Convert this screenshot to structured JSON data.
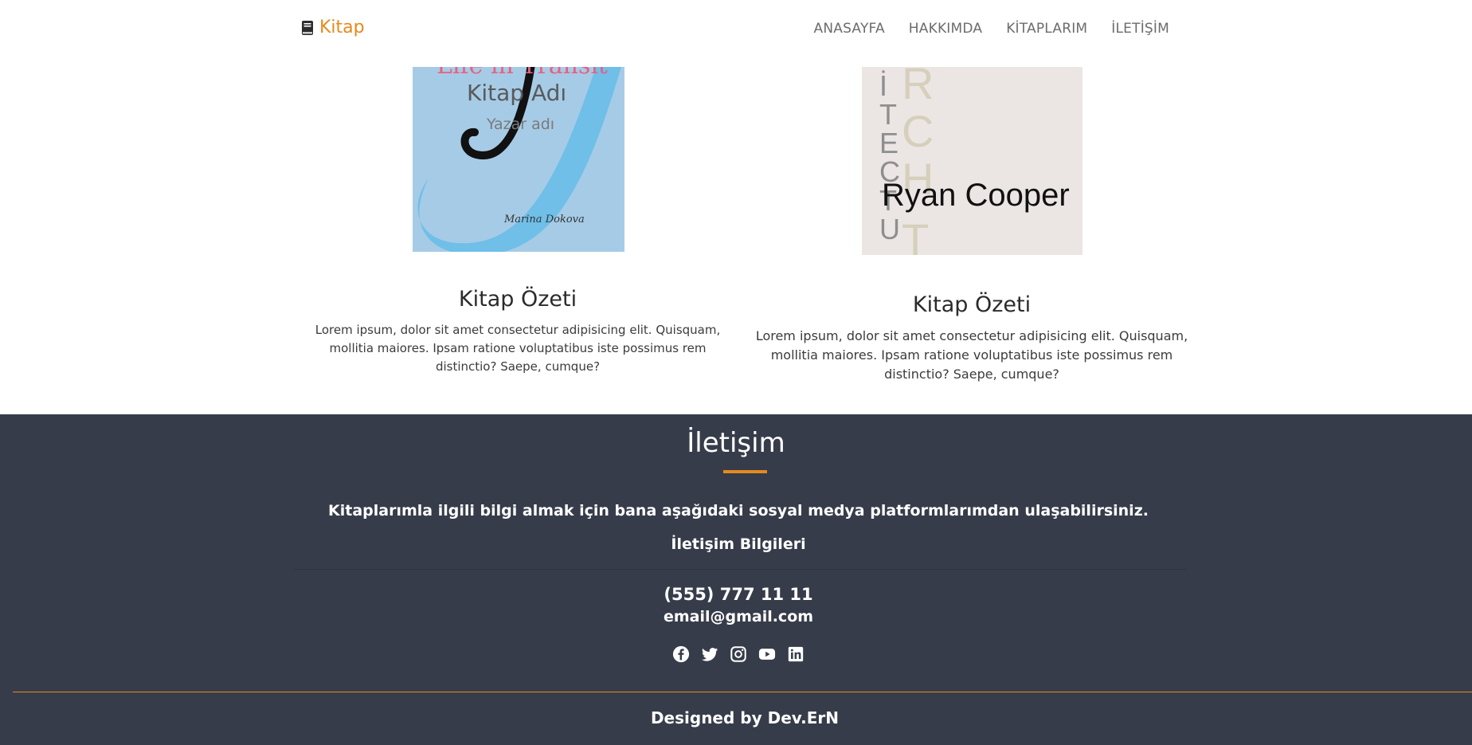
{
  "navbar": {
    "brand": "Kitap",
    "links": [
      "ANASAYFA",
      "HAKKIMDA",
      "KİTAPLARIM",
      "İLETİŞİM"
    ]
  },
  "books": [
    {
      "cover_title_overlay": "Kitap Adı",
      "cover_author_overlay": "Yazar adı",
      "cover_text_top": "Life in Transit",
      "cover_author": "Marina Dokova",
      "heading": "Kitap Özeti",
      "summary": "Lorem ipsum, dolor sit amet consectetur adipisicing elit. Quisquam, mollitia maiores. Ipsam ratione voluptatibus iste possimus rem distinctio? Saepe, cumque?"
    },
    {
      "cover_letters_left": "İTECTUE",
      "cover_letters_right": "RCHT",
      "cover_author": "Ryan Cooper",
      "heading": "Kitap Özeti",
      "summary": "Lorem ipsum, dolor sit amet consectetur adipisicing elit. Quisquam, mollitia maiores. Ipsam ratione voluptatibus iste possimus rem distinctio? Saepe, cumque?"
    }
  ],
  "footer": {
    "title": "İletişim",
    "text": "Kitaplarımla ilgili bilgi almak için bana aşağıdaki sosyal medya platformlarımdan ulaşabilirsiniz.",
    "subtitle": "İletişim Bilgileri",
    "phone": "(555) 777 11 11",
    "email": "email@gmail.com",
    "socials": [
      "facebook-icon",
      "twitter-icon",
      "instagram-icon",
      "youtube-icon",
      "linkedin-icon"
    ],
    "credit": "Designed by Dev.ErN"
  },
  "colors": {
    "accent": "#e58a1f",
    "footer_bg": "#373c4a",
    "cover1_bg": "#a6cbe6",
    "cover2_bg": "#ebe6e4"
  }
}
